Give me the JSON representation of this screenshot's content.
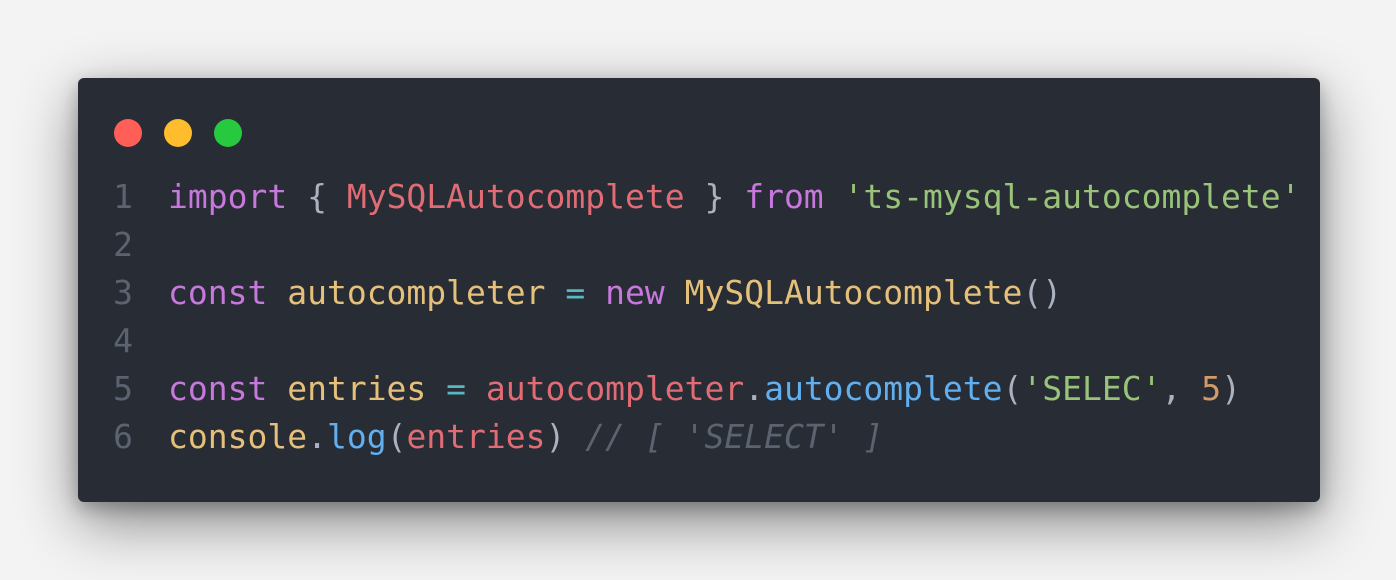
{
  "colors": {
    "background": "#f3f3f3",
    "editor_bg": "#282c34",
    "line_number": "#5c6370",
    "red": "#ff5f56",
    "yellow": "#ffbd2e",
    "green": "#27c93f",
    "keyword": "#c678dd",
    "variable": "#e06c75",
    "class": "#e5c07b",
    "string": "#98c379",
    "operator": "#56b6c2",
    "function": "#61afef",
    "number": "#d19a66",
    "punct": "#abb2bf",
    "comment": "#5c6370"
  },
  "window_controls": [
    {
      "name": "close",
      "color": "#ff5f56"
    },
    {
      "name": "minimize",
      "color": "#ffbd2e"
    },
    {
      "name": "maximize",
      "color": "#27c93f"
    }
  ],
  "lines": [
    {
      "number": "1",
      "tokens": [
        {
          "text": "import",
          "type": "keyword"
        },
        {
          "text": " { ",
          "type": "punct"
        },
        {
          "text": "MySQLAutocomplete",
          "type": "variable"
        },
        {
          "text": " } ",
          "type": "punct"
        },
        {
          "text": "from",
          "type": "keyword"
        },
        {
          "text": " ",
          "type": "punct"
        },
        {
          "text": "'ts-mysql-autocomplete'",
          "type": "string"
        }
      ]
    },
    {
      "number": "2",
      "tokens": []
    },
    {
      "number": "3",
      "tokens": [
        {
          "text": "const",
          "type": "keyword"
        },
        {
          "text": " ",
          "type": "punct"
        },
        {
          "text": "autocompleter",
          "type": "class"
        },
        {
          "text": " ",
          "type": "punct"
        },
        {
          "text": "=",
          "type": "operator"
        },
        {
          "text": " ",
          "type": "punct"
        },
        {
          "text": "new",
          "type": "keyword"
        },
        {
          "text": " ",
          "type": "punct"
        },
        {
          "text": "MySQLAutocomplete",
          "type": "class"
        },
        {
          "text": "()",
          "type": "punct"
        }
      ]
    },
    {
      "number": "4",
      "tokens": []
    },
    {
      "number": "5",
      "tokens": [
        {
          "text": "const",
          "type": "keyword"
        },
        {
          "text": " ",
          "type": "punct"
        },
        {
          "text": "entries",
          "type": "class"
        },
        {
          "text": " ",
          "type": "punct"
        },
        {
          "text": "=",
          "type": "operator"
        },
        {
          "text": " ",
          "type": "punct"
        },
        {
          "text": "autocompleter",
          "type": "variable"
        },
        {
          "text": ".",
          "type": "punct"
        },
        {
          "text": "autocomplete",
          "type": "function"
        },
        {
          "text": "(",
          "type": "punct"
        },
        {
          "text": "'SELEC'",
          "type": "string"
        },
        {
          "text": ", ",
          "type": "punct"
        },
        {
          "text": "5",
          "type": "number"
        },
        {
          "text": ")",
          "type": "punct"
        }
      ]
    },
    {
      "number": "6",
      "tokens": [
        {
          "text": "console",
          "type": "class"
        },
        {
          "text": ".",
          "type": "punct"
        },
        {
          "text": "log",
          "type": "function"
        },
        {
          "text": "(",
          "type": "punct"
        },
        {
          "text": "entries",
          "type": "variable"
        },
        {
          "text": ") ",
          "type": "punct"
        },
        {
          "text": "// [ 'SELECT' ]",
          "type": "comment"
        }
      ]
    }
  ]
}
